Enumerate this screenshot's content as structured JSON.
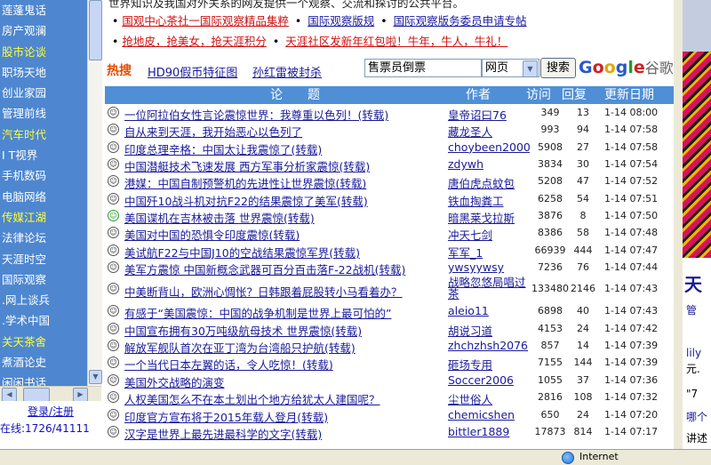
{
  "sidebar": {
    "items": [
      {
        "label": "莲蓬鬼话",
        "color": "white"
      },
      {
        "label": "房产观澜",
        "color": "white"
      },
      {
        "label": "股市论谈",
        "color": "yellow"
      },
      {
        "label": "职场天地",
        "color": "white"
      },
      {
        "label": "创业家园",
        "color": "white"
      },
      {
        "label": "管理前线",
        "color": "white"
      },
      {
        "label": "汽车时代",
        "color": "yellow"
      },
      {
        "label": "I T视界",
        "color": "white"
      },
      {
        "label": "手机数码",
        "color": "white"
      },
      {
        "label": "电脑网络",
        "color": "white"
      },
      {
        "label": "传媒江湖",
        "color": "yellow"
      },
      {
        "label": "法律论坛",
        "color": "white"
      },
      {
        "label": "天涯时空",
        "color": "white"
      },
      {
        "label": "国际观察",
        "color": "white"
      },
      {
        "label": ".网上谈兵",
        "color": "white"
      },
      {
        "label": ".学术中国",
        "color": "white"
      },
      {
        "label": "关天茶舍",
        "color": "yellow"
      },
      {
        "label": "煮酒论史",
        "color": "white"
      },
      {
        "label": "闲闲书话",
        "color": "white"
      }
    ],
    "login_text": "登录/注册",
    "online_text": "在线:1726/41111"
  },
  "notice": {
    "top_line": "世界知识及我国对外关系的网友提供一个观察、交流和探讨的公共平台。",
    "line1": [
      {
        "text": "国观中心茶社一国际观察精品集粹",
        "color": "red"
      },
      {
        "text": "国际观察版规",
        "color": "blue"
      },
      {
        "text": "国际观察版务委员申请专帖",
        "color": "blue"
      }
    ],
    "line2": [
      {
        "text": "抢地皮，抢美女，抢天涯积分",
        "color": "red"
      },
      {
        "text": "天涯社区发新年红包啦！牛年，牛人，牛礼！",
        "color": "red"
      }
    ]
  },
  "search": {
    "hot_logo": "热搜",
    "hot_links": [
      "HD90假币特征图",
      "孙红雷被封杀"
    ],
    "input_value": "售票员倒票",
    "type_value": "网页",
    "button_label": "搜索",
    "google_logo": "Google",
    "google_cn": "谷歌"
  },
  "table": {
    "headers": {
      "title": "论　　题",
      "author": "作者",
      "views": "访问",
      "replies": "回复",
      "date": "更新日期"
    },
    "rows": [
      {
        "title": "一位阿拉伯女性言论震惊世界：我尊重以色列！(转载)",
        "author": "皇帝诏曰76",
        "views": "349",
        "replies": "13",
        "date": "1-14 08:00",
        "face": "normal",
        "red": false
      },
      {
        "title": "自从来到天涯，我开始恶心以色列了",
        "author": "藏龙圣人",
        "views": "993",
        "replies": "94",
        "date": "1-14 07:58",
        "face": "normal",
        "red": false
      },
      {
        "title": "印度总理辛格：中国太让我震惊了(转载)",
        "author": "choybeen2000",
        "views": "5908",
        "replies": "27",
        "date": "1-14 07:58",
        "face": "normal",
        "red": false
      },
      {
        "title": "中国潜艇技术飞速发展 西方军事分析家震惊(转载)",
        "author": "zdywh",
        "views": "3834",
        "replies": "30",
        "date": "1-14 07:54",
        "face": "normal",
        "red": false
      },
      {
        "title": "港媒：中国自制预警机的先进性让世界震惊(转载)",
        "author": "唐伯虎点蚊包",
        "views": "5208",
        "replies": "47",
        "date": "1-14 07:52",
        "face": "normal",
        "red": false
      },
      {
        "title": "中国歼10战斗机对抗F22的结果震惊了美军(转载)",
        "author": "铁血掏粪工",
        "views": "6258",
        "replies": "54",
        "date": "1-14 07:51",
        "face": "normal",
        "red": false
      },
      {
        "title": "美国谍机在吉林被击落 世界震惊(转载)",
        "author": "暗黑莱戈拉斯",
        "views": "3876",
        "replies": "8",
        "date": "1-14 07:50",
        "face": "green",
        "red": false
      },
      {
        "title": "美国对中国的恐惧令印度震惊(转载)",
        "author": "冲天七剑",
        "views": "8386",
        "replies": "58",
        "date": "1-14 07:48",
        "face": "normal",
        "red": false
      },
      {
        "title": "美试航F22与中国J10的空战结果震惊军界(转载)",
        "author": "军军_1",
        "views": "66939",
        "replies": "444",
        "date": "1-14 07:47",
        "face": "normal",
        "red": false
      },
      {
        "title": "美军方震惊 中国新概念武器可百分百击落F-22战机(转载)",
        "author": "ywsyywsy",
        "views": "7236",
        "replies": "76",
        "date": "1-14 07:44",
        "face": "normal",
        "red": false
      },
      {
        "title": "中美断背山，欧洲心惆怅？日韩跟着屁股转小马看着办？",
        "author": "战略忽悠局唱过茶",
        "views": "133480",
        "replies": "2146",
        "date": "1-14 07:43",
        "face": "normal",
        "red": false,
        "tall": true
      },
      {
        "title": "有感于“美国震惊：中国的战争机制是世界上最可怕的”",
        "author": "aleio11",
        "views": "6898",
        "replies": "40",
        "date": "1-14 07:43",
        "face": "normal",
        "red": false
      },
      {
        "title": "中国宣布拥有30万吨级航母技术 世界震惊(转载)",
        "author": "胡说习道",
        "views": "4153",
        "replies": "24",
        "date": "1-14 07:42",
        "face": "normal",
        "red": false
      },
      {
        "title": "解放军舰队首次在亚丁湾为台湾船只护航(转载)",
        "author": "zhchzhsh2076",
        "views": "857",
        "replies": "14",
        "date": "1-14 07:39",
        "face": "normal",
        "red": false
      },
      {
        "title": "一个当代日本左翼的话，令人吃惊！(转载)",
        "author": "砸场专用",
        "views": "7155",
        "replies": "144",
        "date": "1-14 07:39",
        "face": "normal",
        "red": false
      },
      {
        "title": "美国外交战略的演变",
        "author": "Soccer2006",
        "views": "1055",
        "replies": "37",
        "date": "1-14 07:36",
        "face": "normal",
        "red": false
      },
      {
        "title": "人权美国怎么不在本土划出个地方给犹太人建国呢？",
        "author": "尘世俗人",
        "views": "2816",
        "replies": "108",
        "date": "1-14 07:32",
        "face": "normal",
        "red": false
      },
      {
        "title": "印度官方宣布将于2015年载人登月(转载)",
        "author": "chemicshen",
        "views": "650",
        "replies": "24",
        "date": "1-14 07:20",
        "face": "normal",
        "red": false
      },
      {
        "title": "汉字是世界上最先进最科学的文字(转载)",
        "author": "bittler1889",
        "views": "17873",
        "replies": "814",
        "date": "1-14 07:17",
        "face": "normal",
        "red": false
      }
    ]
  },
  "right_panel": {
    "big_char": "天",
    "texts": [
      "管",
      "lily",
      "元.",
      "\"7",
      "哪个",
      "讲述"
    ]
  },
  "statusbar": {
    "zone_text": "Internet"
  }
}
